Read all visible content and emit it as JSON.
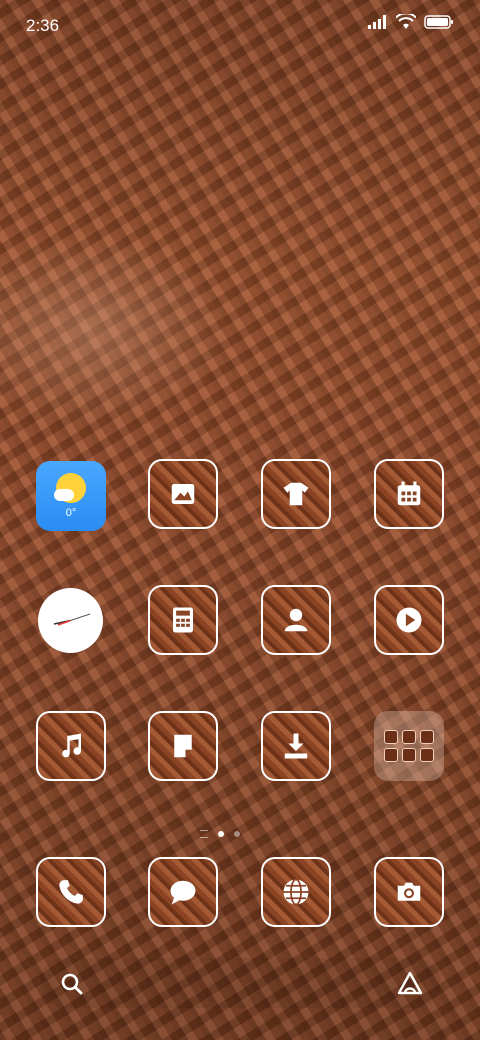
{
  "status": {
    "time": "2:36",
    "icons": [
      "signal-icon",
      "wifi-icon",
      "battery-icon"
    ]
  },
  "weather_widget": {
    "temperature": "0°",
    "icon": "partly-sunny-icon"
  },
  "apps_row1": [
    "gallery-icon",
    "themes-icon",
    "calendar-icon"
  ],
  "apps_row2": [
    "calculator-icon",
    "contacts-icon",
    "video-icon"
  ],
  "apps_row3": [
    "music-icon",
    "notes-icon",
    "downloads-icon"
  ],
  "dock": [
    "phone-icon",
    "messages-icon",
    "browser-icon",
    "camera-icon"
  ],
  "page_indicator": {
    "pages": 2,
    "current": 1
  },
  "bottom_bar": {
    "left_icon": "search-icon",
    "right_icon": "launcher-icon"
  },
  "colors": {
    "wallpaper": "#9a4e2c",
    "icon_border": "#ffffff",
    "weather_bg": "#3b9bff",
    "sun": "#ffd23a"
  }
}
